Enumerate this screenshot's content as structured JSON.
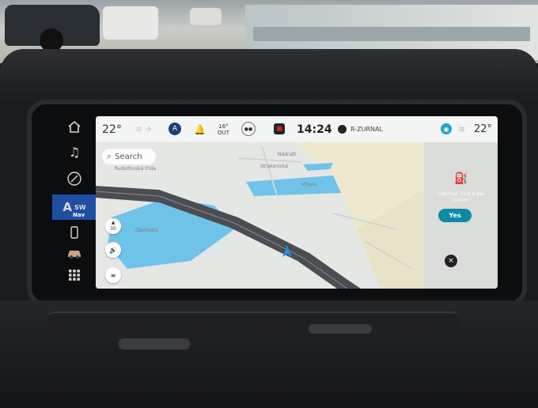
{
  "status_bar": {
    "temp_left": "22°",
    "assistant_badge": "A",
    "outside_temp": "16°",
    "outside_label": "OUT",
    "time": "14:24",
    "media_source": "R-ZURNAL",
    "temp_right": "22°"
  },
  "rail": {
    "nav": {
      "arrow": "A",
      "heading": "SW",
      "label": "Nav"
    }
  },
  "map": {
    "search_placeholder": "Search",
    "speed_limit": "30",
    "labels": [
      "Rudolfovská třída",
      "Vltava",
      "Nádraží",
      "Strakonická",
      "Obchodní"
    ]
  },
  "panel": {
    "fuel_message": "Low fuel. Find a gas station?",
    "yes_label": "Yes",
    "close_glyph": "×"
  },
  "colors": {
    "nav_accent": "#1f4fa3",
    "action_teal": "#0d8aa4",
    "water": "#6fc3e8",
    "route": "#4b4d52"
  }
}
